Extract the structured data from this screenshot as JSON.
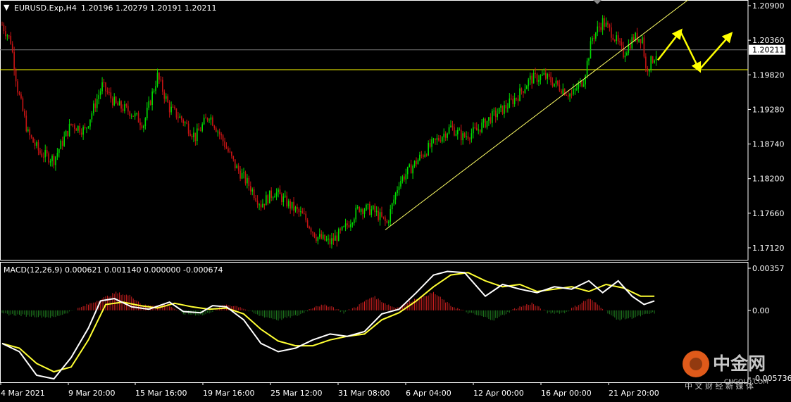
{
  "colors": {
    "background": "#000000",
    "grid": "#ffffff",
    "up_candle": "#00e000",
    "down_candle": "#c81414",
    "hist_up": "#d02020",
    "hist_down": "#1f7a1f",
    "macd_line": "#ffffff",
    "signal_line": "#ffff33",
    "hline": "#ffff00",
    "trendline": "#ffff66",
    "arrows": "#ffff00",
    "text": "#ffffff",
    "price_box_bg": "#ffffff",
    "price_box_text": "#000000",
    "watermark": "#c8c8c8",
    "watermark_logo": "#e05a1a"
  },
  "header": {
    "arrow_glyph": "▼",
    "symbol": "EURUSD.Exp,H4",
    "ohlc": "1.20196 1.20279 1.20191 1.20211"
  },
  "macd_header": "MACD(12,26,9) 0.000621 0.001140 0.000000 -0.000674",
  "current_price_label": "1.20211",
  "watermark": {
    "logo_text": "中金网",
    "url_text": "CNGOLD.COM",
    "tagline": "中 文 财 经 新 媒 体"
  },
  "icon_names": [
    "symbol-dropdown-icon",
    "zigzag-arrow-icon",
    "watermark-logo-icon"
  ],
  "chart_data": [
    {
      "type": "candlestick",
      "symbol": "EURUSD.Exp",
      "timeframe": "H4",
      "ylim": [
        1.1685,
        1.2102
      ],
      "y_ticks": [
        "1.20900",
        "1.20360",
        "1.19820",
        "1.19280",
        "1.18740",
        "1.18200",
        "1.17660",
        "1.17120"
      ],
      "x_ticks": [
        "4 Mar 2021",
        "9 Mar 20:00",
        "15 Mar 16:00",
        "19 Mar 16:00",
        "25 Mar 12:00",
        "31 Mar 08:00",
        "6 Apr 04:00",
        "12 Apr 00:00",
        "16 Apr 00:00",
        "21 Apr 20:00"
      ],
      "close_path": [
        [
          0,
          1.206
        ],
        [
          5,
          1.2035
        ],
        [
          9,
          1.196
        ],
        [
          15,
          1.189
        ],
        [
          22,
          1.186
        ],
        [
          30,
          1.185
        ],
        [
          40,
          1.1905
        ],
        [
          48,
          1.1895
        ],
        [
          58,
          1.1965
        ],
        [
          66,
          1.1935
        ],
        [
          74,
          1.1925
        ],
        [
          82,
          1.1905
        ],
        [
          90,
          1.198
        ],
        [
          97,
          1.193
        ],
        [
          105,
          1.191
        ],
        [
          112,
          1.1885
        ],
        [
          120,
          1.192
        ],
        [
          126,
          1.189
        ],
        [
          135,
          1.184
        ],
        [
          143,
          1.181
        ],
        [
          150,
          1.178
        ],
        [
          158,
          1.18
        ],
        [
          166,
          1.178
        ],
        [
          175,
          1.176
        ],
        [
          182,
          1.173
        ],
        [
          190,
          1.172
        ],
        [
          198,
          1.174
        ],
        [
          207,
          1.1775
        ],
        [
          215,
          1.177
        ],
        [
          223,
          1.175
        ],
        [
          230,
          1.1815
        ],
        [
          238,
          1.184
        ],
        [
          246,
          1.1865
        ],
        [
          252,
          1.188
        ],
        [
          260,
          1.19
        ],
        [
          267,
          1.1885
        ],
        [
          275,
          1.1895
        ],
        [
          283,
          1.1915
        ],
        [
          291,
          1.193
        ],
        [
          299,
          1.195
        ],
        [
          306,
          1.1975
        ],
        [
          314,
          1.198
        ],
        [
          322,
          1.1965
        ],
        [
          330,
          1.195
        ],
        [
          337,
          1.1975
        ],
        [
          342,
          1.204
        ],
        [
          348,
          1.2065
        ],
        [
          354,
          1.2045
        ],
        [
          360,
          1.2015
        ],
        [
          366,
          1.204
        ],
        [
          371,
          1.204
        ],
        [
          373,
          1.199
        ],
        [
          379,
          1.2015
        ]
      ],
      "horizontal_lines": [
        1.20211,
        1.199
      ],
      "trendline": {
        "from": [
          222,
          1.174
        ],
        "to": [
          398,
          1.21
        ]
      },
      "projection_arrows": [
        [
          [
            380,
            1.2005
          ],
          [
            393,
            1.205
          ]
        ],
        [
          [
            393,
            1.205
          ],
          [
            404,
            1.199
          ]
        ],
        [
          [
            404,
            1.199
          ],
          [
            422,
            1.2045
          ]
        ]
      ],
      "last_price": 1.20211
    },
    {
      "type": "macd",
      "name": "MACD(12,26,9)",
      "ylim": [
        -0.0066,
        0.0044
      ],
      "y_ticks": [
        "0.00357",
        "0.00",
        "-0.005736"
      ],
      "macd_path": [
        [
          0,
          -0.0028
        ],
        [
          10,
          -0.0035
        ],
        [
          20,
          -0.0055
        ],
        [
          30,
          -0.0058
        ],
        [
          40,
          -0.004
        ],
        [
          50,
          -0.0015
        ],
        [
          57,
          0.0008
        ],
        [
          65,
          0.001
        ],
        [
          75,
          0.0003
        ],
        [
          85,
          0.0001
        ],
        [
          97,
          0.0007
        ],
        [
          105,
          -0.0001
        ],
        [
          115,
          -0.0002
        ],
        [
          122,
          0.0004
        ],
        [
          130,
          0.0003
        ],
        [
          140,
          -0.0008
        ],
        [
          150,
          -0.0028
        ],
        [
          160,
          -0.0035
        ],
        [
          170,
          -0.0032
        ],
        [
          180,
          -0.0025
        ],
        [
          190,
          -0.002
        ],
        [
          200,
          -0.0022
        ],
        [
          210,
          -0.0018
        ],
        [
          220,
          -0.0003
        ],
        [
          230,
          0.0001
        ],
        [
          240,
          0.0015
        ],
        [
          250,
          0.003
        ],
        [
          258,
          0.0033
        ],
        [
          268,
          0.0032
        ],
        [
          280,
          0.0012
        ],
        [
          290,
          0.0022
        ],
        [
          300,
          0.0018
        ],
        [
          310,
          0.0015
        ],
        [
          320,
          0.002
        ],
        [
          330,
          0.0018
        ],
        [
          340,
          0.0025
        ],
        [
          348,
          0.0015
        ],
        [
          357,
          0.0025
        ],
        [
          365,
          0.0012
        ],
        [
          372,
          0.0005
        ],
        [
          378,
          0.0008
        ]
      ],
      "signal_path": [
        [
          0,
          -0.0028
        ],
        [
          10,
          -0.0032
        ],
        [
          20,
          -0.0045
        ],
        [
          30,
          -0.0052
        ],
        [
          40,
          -0.0048
        ],
        [
          50,
          -0.0025
        ],
        [
          60,
          0.0005
        ],
        [
          70,
          0.0007
        ],
        [
          80,
          0.0004
        ],
        [
          90,
          0.0002
        ],
        [
          100,
          0.0006
        ],
        [
          110,
          0.0003
        ],
        [
          120,
          0.0001
        ],
        [
          130,
          0.0002
        ],
        [
          140,
          -0.0003
        ],
        [
          150,
          -0.0016
        ],
        [
          160,
          -0.0026
        ],
        [
          170,
          -0.003
        ],
        [
          180,
          -0.003
        ],
        [
          190,
          -0.0025
        ],
        [
          200,
          -0.0022
        ],
        [
          210,
          -0.002
        ],
        [
          220,
          -0.0008
        ],
        [
          230,
          -0.0002
        ],
        [
          240,
          0.0008
        ],
        [
          250,
          0.002
        ],
        [
          260,
          0.003
        ],
        [
          270,
          0.0032
        ],
        [
          280,
          0.0025
        ],
        [
          290,
          0.002
        ],
        [
          300,
          0.0022
        ],
        [
          310,
          0.0016
        ],
        [
          320,
          0.0018
        ],
        [
          330,
          0.002
        ],
        [
          340,
          0.0016
        ],
        [
          350,
          0.0022
        ],
        [
          360,
          0.0019
        ],
        [
          370,
          0.0012
        ],
        [
          378,
          0.0012
        ]
      ],
      "hist_path": [
        [
          0,
          -0.0003
        ],
        [
          30,
          -0.0006
        ],
        [
          45,
          0.0002
        ],
        [
          58,
          0.001
        ],
        [
          66,
          0.0015
        ],
        [
          75,
          0.0012
        ],
        [
          82,
          0.0004
        ],
        [
          96,
          0.0005
        ],
        [
          105,
          -0.0003
        ],
        [
          117,
          -0.0004
        ],
        [
          130,
          0.0005
        ],
        [
          138,
          0.0003
        ],
        [
          148,
          -0.0004
        ],
        [
          160,
          -0.0008
        ],
        [
          172,
          -0.0004
        ],
        [
          182,
          0.0004
        ],
        [
          190,
          0.0004
        ],
        [
          198,
          -0.0002
        ],
        [
          205,
          0.0003
        ],
        [
          215,
          0.0012
        ],
        [
          222,
          0.0006
        ],
        [
          228,
          0.0002
        ],
        [
          240,
          0.001
        ],
        [
          250,
          0.0015
        ],
        [
          260,
          0.0004
        ],
        [
          270,
          -0.0002
        ],
        [
          285,
          -0.0008
        ],
        [
          298,
          0.0002
        ],
        [
          307,
          0.0006
        ],
        [
          316,
          -0.0002
        ],
        [
          326,
          -0.0002
        ],
        [
          340,
          0.001
        ],
        [
          348,
          0.0002
        ],
        [
          356,
          -0.0008
        ],
        [
          366,
          -0.0006
        ],
        [
          372,
          -0.0004
        ],
        [
          378,
          -0.0002
        ]
      ]
    }
  ]
}
